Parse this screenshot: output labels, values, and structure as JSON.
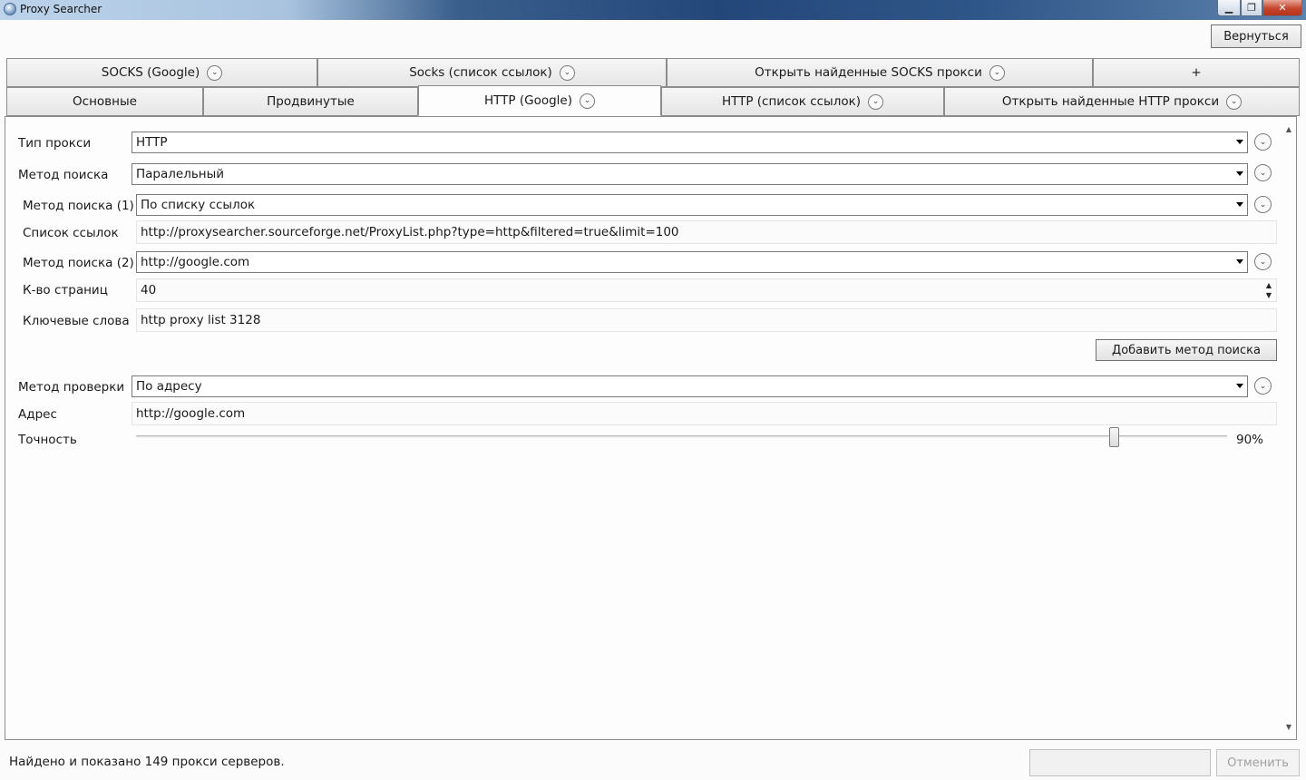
{
  "window": {
    "title": "Proxy Searcher",
    "min_glyph": "▁",
    "max_glyph": "❐",
    "close_glyph": "✕"
  },
  "toolbar": {
    "back_label": "Вернуться"
  },
  "tabs": {
    "row1": [
      {
        "label": "SOCKS (Google)",
        "has_menu": true
      },
      {
        "label": "Socks (список ссылок)",
        "has_menu": true
      },
      {
        "label": "Открыть найденные SOCKS прокси",
        "has_menu": true
      },
      {
        "label": "+",
        "has_menu": false
      }
    ],
    "row2": [
      {
        "label": "Основные",
        "has_menu": false
      },
      {
        "label": "Продвинутые",
        "has_menu": false
      },
      {
        "label": "HTTP (Google)",
        "has_menu": true,
        "selected": true
      },
      {
        "label": "HTTP (список ссылок)",
        "has_menu": true
      },
      {
        "label": "Открыть найденные HTTP прокси",
        "has_menu": true
      }
    ],
    "menu_glyph": "⌄"
  },
  "form": {
    "proxy_type": {
      "label": "Тип прокси",
      "value": "HTTP"
    },
    "search_method": {
      "label": "Метод поиска",
      "value": "Паралельный"
    },
    "search_method_1": {
      "label": "Метод поиска (1)",
      "value": "По списку ссылок"
    },
    "link_list": {
      "label": "Список ссылок",
      "value": "http://proxysearcher.sourceforge.net/ProxyList.php?type=http&filtered=true&limit=100"
    },
    "search_method_2": {
      "label": "Метод поиска (2)",
      "value": "http://google.com"
    },
    "pages_count": {
      "label": "К-во страниц",
      "value": "40"
    },
    "keywords": {
      "label": "Ключевые слова",
      "value": "http proxy list 3128"
    },
    "add_search_method_label": "Добавить метод поиска",
    "check_method": {
      "label": "Метод проверки",
      "value": "По адресу"
    },
    "address": {
      "label": "Адрес",
      "value": "http://google.com"
    },
    "accuracy": {
      "label": "Точность",
      "value_text": "90%",
      "value": 0.9
    }
  },
  "status": {
    "text": "Найдено и показано 149 прокси серверов.",
    "cancel_label": "Отменить"
  }
}
